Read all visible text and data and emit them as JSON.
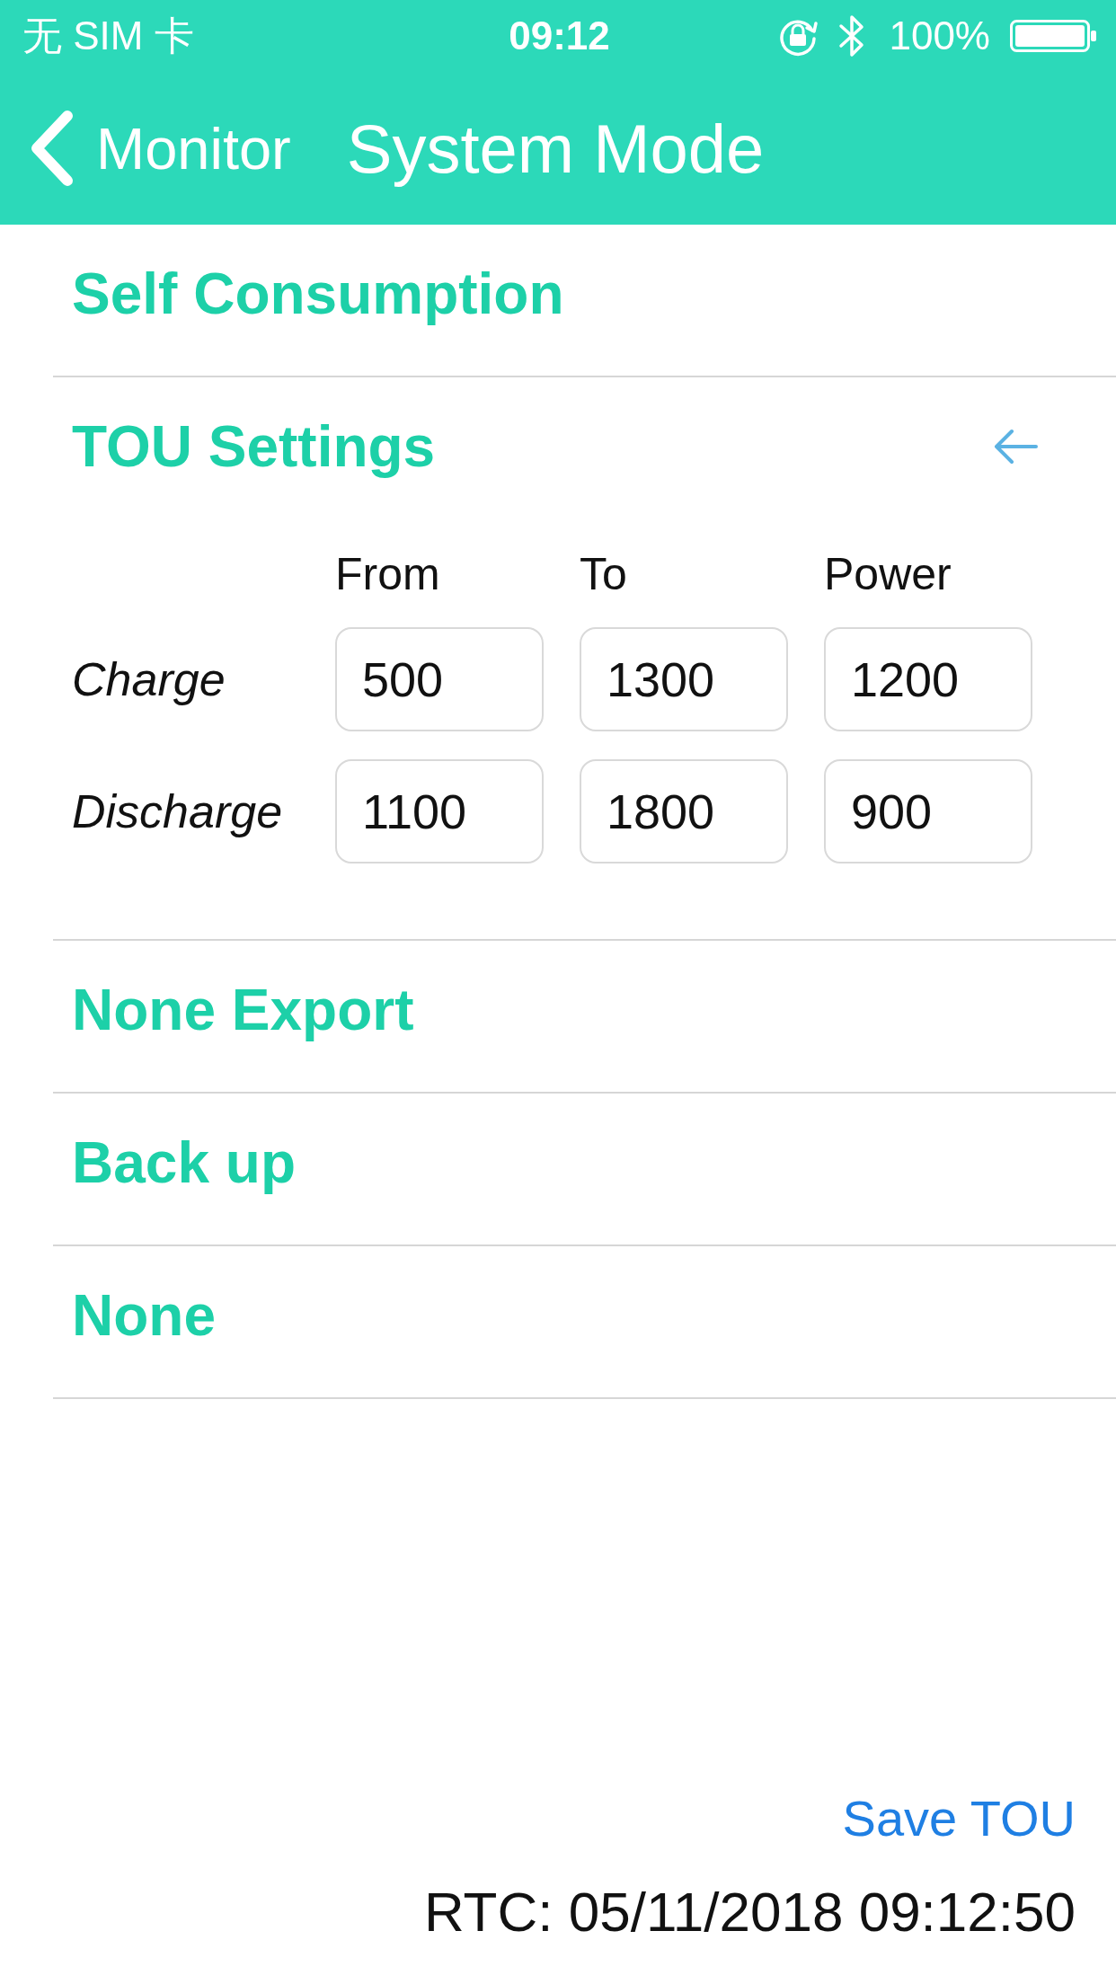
{
  "status_bar": {
    "carrier": "无 SIM 卡",
    "time": "09:12",
    "battery": "100%"
  },
  "nav": {
    "back_label": "Monitor",
    "title": "System Mode"
  },
  "modes": [
    {
      "label": "Self Consumption"
    },
    {
      "label": "TOU Settings",
      "expanded": true,
      "settings": {
        "columns": [
          "From",
          "To",
          "Power"
        ],
        "rows": [
          {
            "label": "Charge",
            "values": [
              "500",
              "1300",
              "1200"
            ]
          },
          {
            "label": "Discharge",
            "values": [
              "1100",
              "1800",
              "900"
            ]
          }
        ]
      }
    },
    {
      "label": "None Export"
    },
    {
      "label": "Back up"
    },
    {
      "label": "None"
    }
  ],
  "save_button": "Save TOU",
  "rtc": "RTC: 05/11/2018 09:12:50"
}
